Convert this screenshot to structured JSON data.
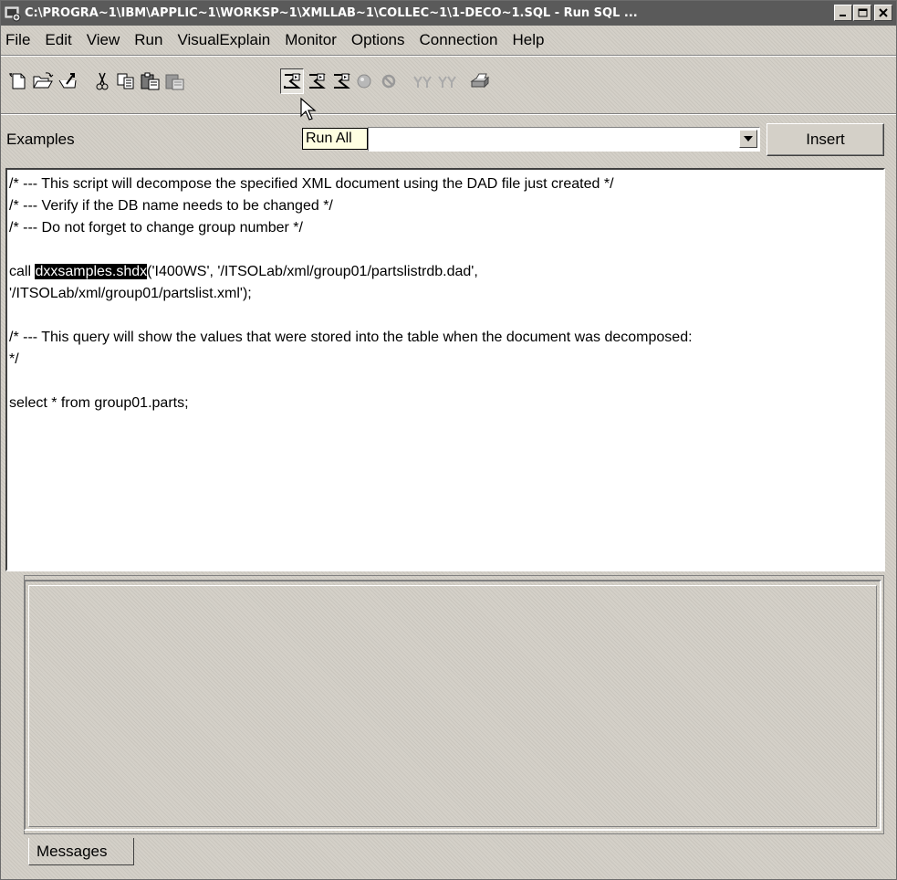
{
  "window": {
    "title": "C:\\PROGRA~1\\IBM\\APPLIC~1\\WORKSP~1\\XMLLAB~1\\COLLEC~1\\1-DECO~1.SQL - Run SQL ...",
    "minimize_label": "_",
    "maximize_label": "□",
    "close_label": "×"
  },
  "menu": [
    "File",
    "Edit",
    "View",
    "Run",
    "VisualExplain",
    "Monitor",
    "Options",
    "Connection",
    "Help"
  ],
  "toolbar": {
    "icons": [
      "new-icon",
      "open-icon",
      "save-icon",
      "cut-icon",
      "copy-icon",
      "paste-icon",
      "paste-disabled-icon",
      "run-all-icon",
      "run-from-selected-icon",
      "run-selected-icon",
      "stop-icon",
      "cancel-icon",
      "explain-icon",
      "explain-run-icon",
      "print-icon"
    ]
  },
  "examples": {
    "label": "Examples",
    "value": "",
    "insert_label": "Insert"
  },
  "tooltip": "Run All",
  "editor": {
    "lines": [
      "/* --- This script will decompose the specified XML document using the DAD file just created */",
      "/* --- Verify if the DB name needs to be changed */",
      "/* --- Do not forget to change group number */",
      "",
      "",
      "'/ITSOLab/xml/group01/partslist.xml');",
      "",
      "/* --- This query will show the values that were stored into the table when the document was decomposed:",
      "*/",
      "",
      "select * from group01.parts;"
    ],
    "call_prefix": "call ",
    "call_selected": "dxxsamples.shdx",
    "call_suffix": "('I400WS', '/ITSOLab/xml/group01/partslistrdb.dad',"
  },
  "messages": {
    "tab_label": "Messages"
  }
}
